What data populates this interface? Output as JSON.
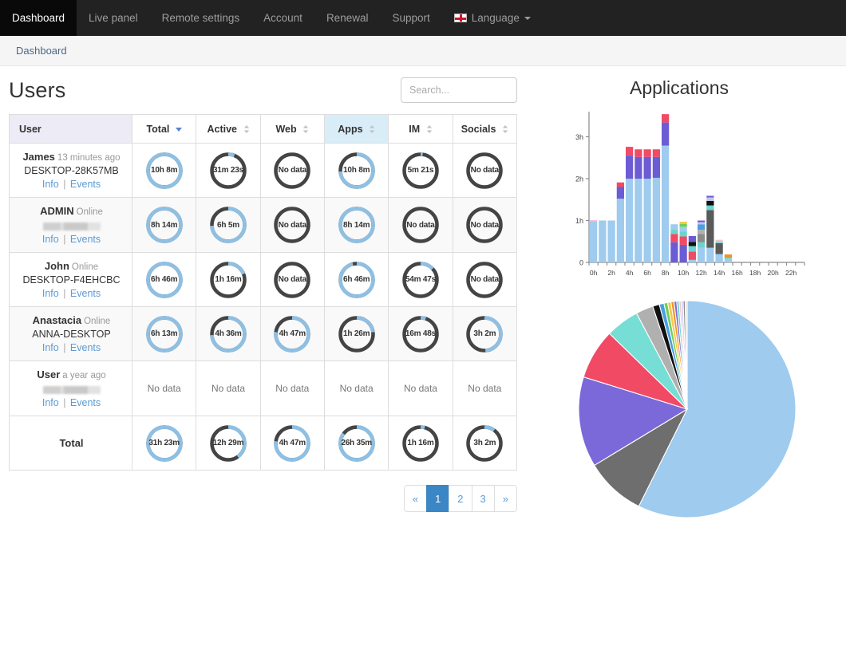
{
  "navbar": {
    "items": [
      {
        "label": "Dashboard",
        "active": true
      },
      {
        "label": "Live panel",
        "active": false
      },
      {
        "label": "Remote settings",
        "active": false
      },
      {
        "label": "Account",
        "active": false
      },
      {
        "label": "Renewal",
        "active": false
      },
      {
        "label": "Support",
        "active": false
      }
    ],
    "language_label": "Language",
    "language_icon": "flag-icon"
  },
  "breadcrumb": {
    "label": "Dashboard"
  },
  "users_panel": {
    "title": "Users",
    "search_placeholder": "Search...",
    "search_value": "",
    "columns": [
      {
        "label": "User",
        "sort": "none",
        "key": "user"
      },
      {
        "label": "Total",
        "sort": "desc",
        "key": "total"
      },
      {
        "label": "Active",
        "sort": "both",
        "key": "active"
      },
      {
        "label": "Web",
        "sort": "both",
        "key": "web"
      },
      {
        "label": "Apps",
        "sort": "both",
        "key": "apps",
        "highlighted": true
      },
      {
        "label": "IM",
        "sort": "both",
        "key": "im"
      },
      {
        "label": "Socials",
        "sort": "both",
        "key": "socials"
      }
    ],
    "nodata_label": "No data",
    "info_label": "Info",
    "events_label": "Events",
    "separator": "|",
    "rows": [
      {
        "name": "James",
        "status": "13 minutes ago",
        "machine": "DESKTOP-28K57MB",
        "redacted": false,
        "cells": [
          {
            "value": "10h 8m",
            "pct": 100,
            "color": "blue"
          },
          {
            "value": "31m 23s",
            "pct": 6,
            "color": "blue"
          },
          {
            "value": "No data",
            "pct": 0,
            "color": "none"
          },
          {
            "value": "10h 8m",
            "pct": 74,
            "color": "blue"
          },
          {
            "value": "5m 21s",
            "pct": 2,
            "color": "blue"
          },
          {
            "value": "No data",
            "pct": 0,
            "color": "none"
          }
        ]
      },
      {
        "name": "ADMIN",
        "status": "Online",
        "machine": "",
        "redacted": true,
        "cells": [
          {
            "value": "8h 14m",
            "pct": 100,
            "color": "blue"
          },
          {
            "value": "6h 5m",
            "pct": 74,
            "color": "blue"
          },
          {
            "value": "No data",
            "pct": 0,
            "color": "none"
          },
          {
            "value": "8h 14m",
            "pct": 100,
            "color": "blue"
          },
          {
            "value": "No data",
            "pct": 0,
            "color": "none"
          },
          {
            "value": "No data",
            "pct": 0,
            "color": "none"
          }
        ]
      },
      {
        "name": "John",
        "status": "Online",
        "machine": "DESKTOP-F4EHCBC",
        "redacted": false,
        "cells": [
          {
            "value": "6h 46m",
            "pct": 100,
            "color": "blue"
          },
          {
            "value": "1h 16m",
            "pct": 19,
            "color": "blue"
          },
          {
            "value": "No data",
            "pct": 0,
            "color": "none"
          },
          {
            "value": "6h 46m",
            "pct": 96,
            "color": "blue"
          },
          {
            "value": "54m 47s",
            "pct": 13,
            "color": "blue"
          },
          {
            "value": "No data",
            "pct": 0,
            "color": "none"
          }
        ]
      },
      {
        "name": "Anastacia",
        "status": "Online",
        "machine": "ANNA-DESKTOP",
        "redacted": false,
        "cells": [
          {
            "value": "6h 13m",
            "pct": 100,
            "color": "blue"
          },
          {
            "value": "4h 36m",
            "pct": 74,
            "color": "blue"
          },
          {
            "value": "4h 47m",
            "pct": 77,
            "color": "blue"
          },
          {
            "value": "1h 26m",
            "pct": 23,
            "color": "blue"
          },
          {
            "value": "16m 48s",
            "pct": 5,
            "color": "blue"
          },
          {
            "value": "3h 2m",
            "pct": 49,
            "color": "blue"
          }
        ]
      },
      {
        "name": "User",
        "status": "a year ago",
        "machine": "",
        "redacted": true,
        "cells": [
          {
            "value": "No data",
            "pct": 0,
            "color": "none",
            "flat": true
          },
          {
            "value": "No data",
            "pct": 0,
            "color": "none",
            "flat": true
          },
          {
            "value": "No data",
            "pct": 0,
            "color": "none",
            "flat": true
          },
          {
            "value": "No data",
            "pct": 0,
            "color": "none",
            "flat": true
          },
          {
            "value": "No data",
            "pct": 0,
            "color": "none",
            "flat": true
          },
          {
            "value": "No data",
            "pct": 0,
            "color": "none",
            "flat": true
          }
        ]
      }
    ],
    "total_row": {
      "label": "Total",
      "cells": [
        {
          "value": "31h 23m",
          "pct": 100,
          "color": "blue"
        },
        {
          "value": "12h 29m",
          "pct": 40,
          "color": "blue"
        },
        {
          "value": "4h 47m",
          "pct": 77,
          "color": "blue"
        },
        {
          "value": "26h 35m",
          "pct": 85,
          "color": "blue"
        },
        {
          "value": "1h 16m",
          "pct": 4,
          "color": "blue"
        },
        {
          "value": "3h 2m",
          "pct": 10,
          "color": "blue"
        }
      ]
    },
    "pagination": {
      "prev": "«",
      "next": "»",
      "pages": [
        "1",
        "2",
        "3"
      ],
      "current": "1"
    }
  },
  "applications_panel": {
    "title": "Applications",
    "chart_data": [
      {
        "type": "bar",
        "stacked": true,
        "title": "Applications",
        "xlabel": "",
        "ylabel": "",
        "ylim": [
          0,
          3.6
        ],
        "ytick_labels": [
          "0",
          "1h",
          "2h",
          "3h"
        ],
        "ytick_values": [
          0,
          1,
          2,
          3
        ],
        "grid": false,
        "legend": "none",
        "categories": [
          "0h",
          "1h",
          "2h",
          "3h",
          "4h",
          "5h",
          "6h",
          "7h",
          "8h",
          "9h",
          "10h",
          "11h",
          "12h",
          "13h",
          "14h",
          "15h",
          "16h",
          "17h",
          "18h",
          "19h",
          "20h",
          "21h",
          "22h",
          "23h"
        ],
        "xtick_labels": [
          "0h",
          "2h",
          "4h",
          "6h",
          "8h",
          "10h",
          "12h",
          "14h",
          "16h",
          "18h",
          "20h",
          "22h"
        ],
        "bars": [
          {
            "x": "0h",
            "segments": [
              {
                "color": "#9ecbee",
                "value": 0.98
              },
              {
                "color": "#f4c2cf",
                "value": 0.03
              }
            ]
          },
          {
            "x": "1h",
            "segments": [
              {
                "color": "#9ecbee",
                "value": 1.0
              }
            ]
          },
          {
            "x": "2h",
            "segments": [
              {
                "color": "#9ecbee",
                "value": 1.0
              }
            ]
          },
          {
            "x": "3h",
            "segments": [
              {
                "color": "#9ecbee",
                "value": 1.52
              },
              {
                "color": "#6b5cd4",
                "value": 0.28
              },
              {
                "color": "#f04a65",
                "value": 0.11
              }
            ]
          },
          {
            "x": "4h",
            "segments": [
              {
                "color": "#9ecbee",
                "value": 2.0
              },
              {
                "color": "#6b5cd4",
                "value": 0.55
              },
              {
                "color": "#f04a65",
                "value": 0.21
              }
            ]
          },
          {
            "x": "5h",
            "segments": [
              {
                "color": "#9ecbee",
                "value": 2.0
              },
              {
                "color": "#6b5cd4",
                "value": 0.52
              },
              {
                "color": "#f04a65",
                "value": 0.18
              }
            ]
          },
          {
            "x": "6h",
            "segments": [
              {
                "color": "#9ecbee",
                "value": 2.0
              },
              {
                "color": "#6b5cd4",
                "value": 0.52
              },
              {
                "color": "#f04a65",
                "value": 0.18
              }
            ]
          },
          {
            "x": "7h",
            "segments": [
              {
                "color": "#9ecbee",
                "value": 2.02
              },
              {
                "color": "#6b5cd4",
                "value": 0.5
              },
              {
                "color": "#f04a65",
                "value": 0.18
              }
            ]
          },
          {
            "x": "8h",
            "segments": [
              {
                "color": "#9ecbee",
                "value": 2.79
              },
              {
                "color": "#6b5cd4",
                "value": 0.55
              },
              {
                "color": "#f04a65",
                "value": 0.2
              }
            ]
          },
          {
            "x": "9h",
            "segments": [
              {
                "color": "#6b5cd4",
                "value": 0.48
              },
              {
                "color": "#f04a65",
                "value": 0.2
              },
              {
                "color": "#6ad4cd",
                "value": 0.1
              },
              {
                "color": "#9ecbee",
                "value": 0.13
              }
            ]
          },
          {
            "x": "10h",
            "segments": [
              {
                "color": "#6b5cd4",
                "value": 0.42
              },
              {
                "color": "#f04a65",
                "value": 0.2
              },
              {
                "color": "#6ad4cd",
                "value": 0.12
              },
              {
                "color": "#9ecbee",
                "value": 0.11
              },
              {
                "color": "#6ece5a",
                "value": 0.07
              },
              {
                "color": "#f5c842",
                "value": 0.05
              }
            ]
          },
          {
            "x": "11h",
            "segments": [
              {
                "color": "#9ecbee",
                "value": 0.06
              },
              {
                "color": "#f04a65",
                "value": 0.2
              },
              {
                "color": "#6ad4cd",
                "value": 0.13
              },
              {
                "color": "#111111",
                "value": 0.1
              },
              {
                "color": "#6b5cd4",
                "value": 0.14
              }
            ]
          },
          {
            "x": "12h",
            "segments": [
              {
                "color": "#9ecbee",
                "value": 0.35
              },
              {
                "color": "#6ad4cd",
                "value": 0.13
              },
              {
                "color": "#8b8b8b",
                "value": 0.2
              },
              {
                "color": "#b0b0b0",
                "value": 0.1
              },
              {
                "color": "#4a9fe0",
                "value": 0.13
              },
              {
                "color": "#c4c4ee",
                "value": 0.05
              },
              {
                "color": "#6b5cd4",
                "value": 0.04
              }
            ]
          },
          {
            "x": "13h",
            "segments": [
              {
                "color": "#9ecbee",
                "value": 0.35
              },
              {
                "color": "#5a5a5a",
                "value": 0.9
              },
              {
                "color": "#6ad4cd",
                "value": 0.11
              },
              {
                "color": "#111111",
                "value": 0.11
              },
              {
                "color": "#c4c4ee",
                "value": 0.08
              },
              {
                "color": "#6b5cd4",
                "value": 0.04
              }
            ]
          },
          {
            "x": "14h",
            "segments": [
              {
                "color": "#9ecbee",
                "value": 0.2
              },
              {
                "color": "#5a5a5a",
                "value": 0.26
              },
              {
                "color": "#6ad4cd",
                "value": 0.03
              },
              {
                "color": "#f4c2cf",
                "value": 0.05
              }
            ]
          },
          {
            "x": "15h",
            "segments": [
              {
                "color": "#9ecbee",
                "value": 0.08
              },
              {
                "color": "#6ad4cd",
                "value": 0.03
              },
              {
                "color": "#f0932b",
                "value": 0.08
              }
            ]
          },
          {
            "x": "16h",
            "segments": []
          },
          {
            "x": "17h",
            "segments": []
          },
          {
            "x": "18h",
            "segments": []
          },
          {
            "x": "19h",
            "segments": []
          },
          {
            "x": "20h",
            "segments": []
          },
          {
            "x": "21h",
            "segments": []
          },
          {
            "x": "22h",
            "segments": []
          },
          {
            "x": "23h",
            "segments": []
          }
        ]
      },
      {
        "type": "pie",
        "title": "",
        "legend": "none",
        "start_angle_deg": -90,
        "slices": [
          {
            "color": "#9ecbee",
            "value": 57.5
          },
          {
            "color": "#6e6e6e",
            "value": 9.0
          },
          {
            "color": "#7b68d9",
            "value": 13.5
          },
          {
            "color": "#f04a65",
            "value": 7.5
          },
          {
            "color": "#76ded4",
            "value": 5.0
          },
          {
            "color": "#b0b0b0",
            "value": 2.6
          },
          {
            "color": "#111111",
            "value": 1.0
          },
          {
            "color": "#4a9fe0",
            "value": 0.7
          },
          {
            "color": "#6ece5a",
            "value": 0.55
          },
          {
            "color": "#f5c842",
            "value": 0.5
          },
          {
            "color": "#f0932b",
            "value": 0.45
          },
          {
            "color": "#7b68d9",
            "value": 0.4
          },
          {
            "color": "#6ad4cd",
            "value": 0.35
          },
          {
            "color": "#f4c2cf",
            "value": 0.3
          },
          {
            "color": "#c4c4ee",
            "value": 0.3
          },
          {
            "color": "#8b8b8b",
            "value": 0.3
          },
          {
            "color": "#dddddd",
            "value": 0.3
          }
        ]
      }
    ]
  }
}
